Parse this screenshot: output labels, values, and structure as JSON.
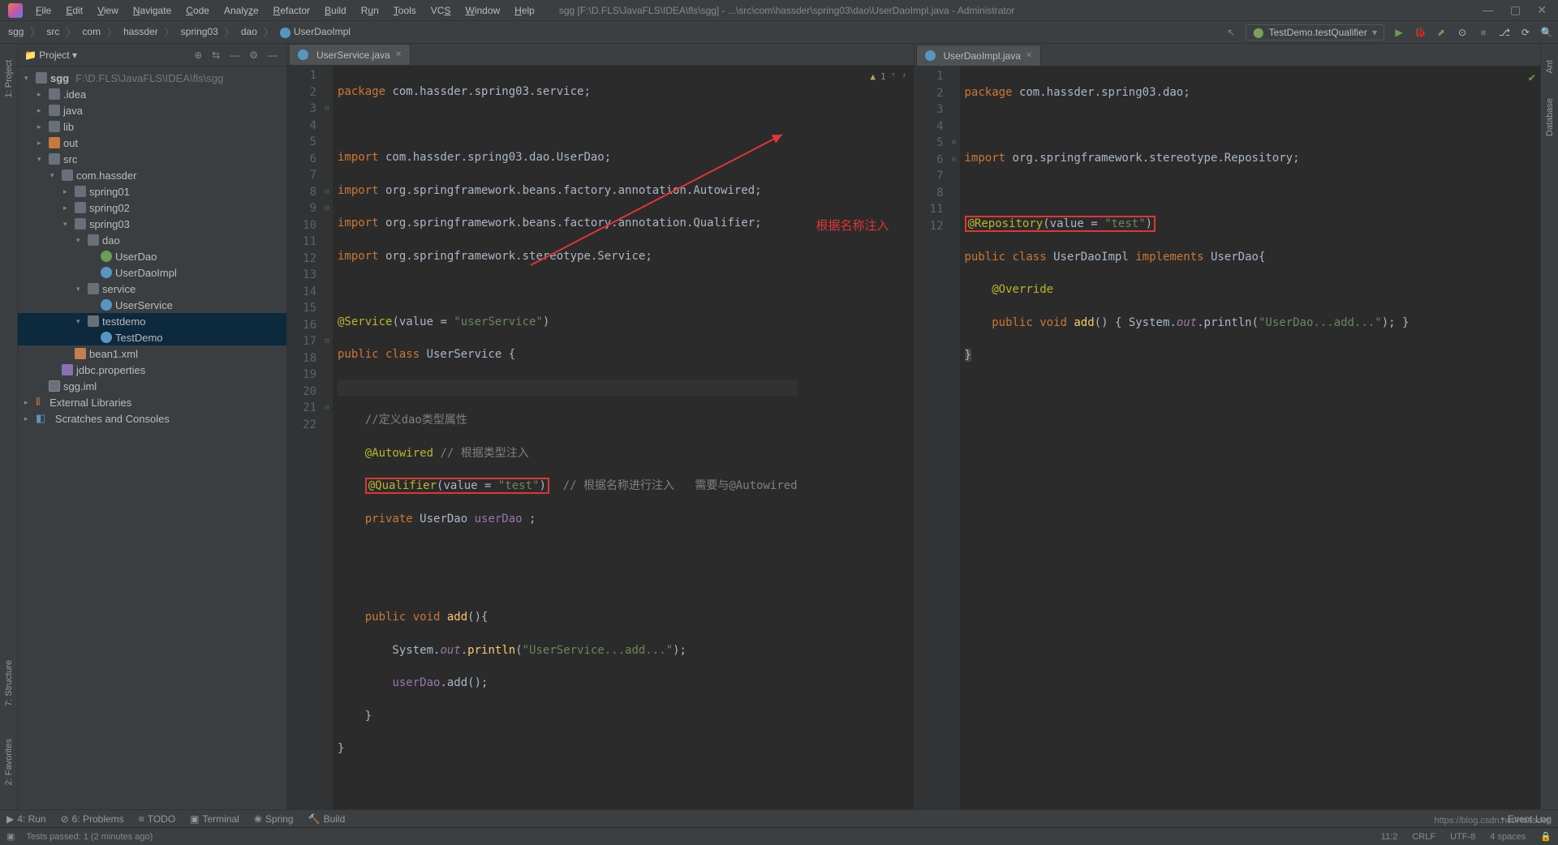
{
  "menu": [
    "File",
    "Edit",
    "View",
    "Navigate",
    "Code",
    "Analyze",
    "Refactor",
    "Build",
    "Run",
    "Tools",
    "VCS",
    "Window",
    "Help"
  ],
  "titleBar": "sgg [F:\\D.FLS\\JavaFLS\\IDEA\\fls\\sgg] - ...\\src\\com\\hassder\\spring03\\dao\\UserDaoImpl.java - Administrator",
  "breadcrumbs": [
    "sgg",
    "src",
    "com",
    "hassder",
    "spring03",
    "dao",
    "UserDaoImpl"
  ],
  "runConfig": "TestDemo.testQualifier",
  "projectPanel": {
    "title": "Project"
  },
  "tree": {
    "root": {
      "name": "sgg",
      "path": "F:\\D.FLS\\JavaFLS\\IDEA\\fls\\sgg"
    },
    "items": [
      {
        "d": 1,
        "t": "folder",
        "n": ".idea",
        "exp": false
      },
      {
        "d": 1,
        "t": "folder",
        "n": "java",
        "exp": false
      },
      {
        "d": 1,
        "t": "folder",
        "n": "lib",
        "exp": false
      },
      {
        "d": 1,
        "t": "folder-orange",
        "n": "out",
        "exp": false
      },
      {
        "d": 1,
        "t": "folder",
        "n": "src",
        "exp": true
      },
      {
        "d": 2,
        "t": "folder",
        "n": "com.hassder",
        "exp": true
      },
      {
        "d": 3,
        "t": "folder",
        "n": "spring01",
        "exp": false
      },
      {
        "d": 3,
        "t": "folder",
        "n": "spring02",
        "exp": false
      },
      {
        "d": 3,
        "t": "folder",
        "n": "spring03",
        "exp": true
      },
      {
        "d": 4,
        "t": "folder",
        "n": "dao",
        "exp": true
      },
      {
        "d": 5,
        "t": "iface",
        "n": "UserDao"
      },
      {
        "d": 5,
        "t": "jclass",
        "n": "UserDaoImpl"
      },
      {
        "d": 4,
        "t": "folder",
        "n": "service",
        "exp": true
      },
      {
        "d": 5,
        "t": "jclass",
        "n": "UserService"
      },
      {
        "d": 4,
        "t": "folder",
        "n": "testdemo",
        "exp": true,
        "sel": true
      },
      {
        "d": 5,
        "t": "jclass",
        "n": "TestDemo",
        "sel": true
      },
      {
        "d": 3,
        "t": "xml",
        "n": "bean1.xml"
      },
      {
        "d": 2,
        "t": "prop",
        "n": "jdbc.properties"
      },
      {
        "d": 1,
        "t": "module",
        "n": "sgg.iml"
      }
    ],
    "extLib": "External Libraries",
    "scratch": "Scratches and Consoles"
  },
  "leftTabs": [
    "1: Project"
  ],
  "leftTabsBottom": [
    "2: Favorites",
    "7: Structure"
  ],
  "rightTabs": [
    "Ant",
    "Database"
  ],
  "editors": {
    "left": {
      "tab": "UserService.java",
      "warnCount": "1",
      "lines": [
        1,
        2,
        3,
        4,
        5,
        6,
        7,
        8,
        9,
        10,
        11,
        12,
        13,
        14,
        15,
        16,
        17,
        18,
        19,
        20,
        21,
        22
      ],
      "code": {
        "l1a": "package",
        "l1b": " com.hassder.spring03.service;",
        "l3a": "import",
        "l3b": " com.hassder.spring03.dao.UserDao;",
        "l4a": "import",
        "l4b": " org.springframework.beans.factory.annotation.",
        "l4c": "Autowired",
        "l4d": ";",
        "l5a": "import",
        "l5b": " org.springframework.beans.factory.annotation.",
        "l5c": "Qualifier",
        "l5d": ";",
        "l6a": "import",
        "l6b": " org.springframework.stereotype.",
        "l6c": "Service",
        "l6d": ";",
        "l8a": "@Service",
        "l8b": "(value = ",
        "l8c": "\"userService\"",
        "l8d": ")",
        "l9a": "public class ",
        "l9b": "UserService {",
        "l11a": "    //定义dao类型属性",
        "l12a": "    ",
        "l12b": "@Autowired",
        "l12c": " // 根据类型注入",
        "l13a": "    ",
        "l13b": "@Qualifier",
        "l13c": "(value = ",
        "l13d": "\"test\"",
        "l13e": ")",
        "l13f": "  // 根据名称进行注入   需要与@Autowired",
        "l14a": "    ",
        "l14b": "private ",
        "l14c": "UserDao ",
        "l14d": "userDao",
        "l14e": " ;",
        "l17a": "    ",
        "l17b": "public void ",
        "l17c": "add",
        "l17d": "(){",
        "l18a": "        System.",
        "l18b": "out",
        "l18c": ".",
        "l18d": "println",
        "l18e": "(",
        "l18f": "\"UserService...add...\"",
        "l18g": ");",
        "l19a": "        ",
        "l19b": "userDao",
        "l19c": ".add();",
        "l20": "    }",
        "l21": "}"
      },
      "annotation": "根据名称注入"
    },
    "right": {
      "tab": "UserDaoImpl.java",
      "lines": [
        1,
        2,
        3,
        4,
        5,
        6,
        7,
        8,
        11,
        12
      ],
      "code": {
        "l1a": "package",
        "l1b": " com.hassder.spring03.dao;",
        "l3a": "import",
        "l3b": " org.springframework.stereotype.Repository;",
        "l5a": "@Repository",
        "l5b": "(value = ",
        "l5c": "\"test\"",
        "l5d": ")",
        "l6a": "public class ",
        "l6b": "UserDaoImpl ",
        "l6c": "implements ",
        "l6d": "UserDao",
        "l6e": "{",
        "l7a": "    ",
        "l7b": "@Override",
        "l8a": "    ",
        "l8b": "public void ",
        "l8c": "add",
        "l8d": "() { System.",
        "l8e": "out",
        "l8f": ".println(",
        "l8g": "\"UserDao...add...\"",
        "l8h": "); }",
        "l11": "}"
      }
    }
  },
  "bottomTabs": [
    "4: Run",
    "6: Problems",
    "TODO",
    "Terminal",
    "Spring",
    "Build"
  ],
  "eventLog": "Event Log",
  "status": {
    "tests": "Tests passed: 1 (2 minutes ago)",
    "pos": "11:2",
    "crlf": "CRLF",
    "enc": "UTF-8",
    "indent": "4 spaces"
  },
  "watermark": "https://blog.csdn.net/Hassder"
}
